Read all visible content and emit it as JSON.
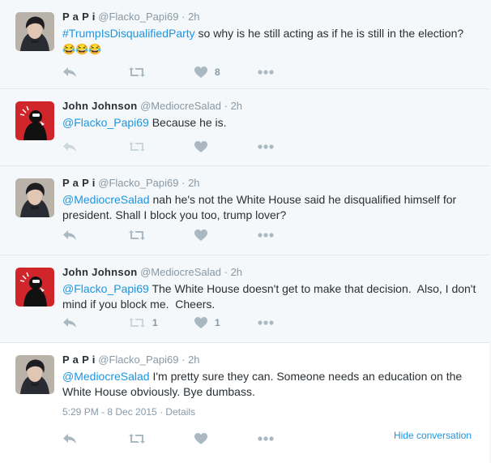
{
  "tweets": [
    {
      "fullname": "P a P i",
      "username": "@Flacko_Papi69",
      "separator": "·",
      "time": "2h",
      "parts": [
        {
          "text": "#TrumpIsDisqualifiedParty",
          "kind": "link"
        },
        {
          "text": " so why is he still acting as if he is still in the election?",
          "kind": "plain"
        }
      ],
      "emoji": "😂😂😂",
      "avatar": "avatar-papi",
      "retweet_count": "",
      "like_count": "8"
    },
    {
      "fullname": "John Johnson",
      "username": "@MediocreSalad",
      "separator": "·",
      "time": "2h",
      "parts": [
        {
          "text": "@Flacko_Papi69",
          "kind": "link"
        },
        {
          "text": " Because he is.",
          "kind": "plain"
        }
      ],
      "avatar": "avatar-john",
      "retweet_count": "",
      "like_count": ""
    },
    {
      "fullname": "P a P i",
      "username": "@Flacko_Papi69",
      "separator": "·",
      "time": "2h",
      "parts": [
        {
          "text": "@MediocreSalad",
          "kind": "link"
        },
        {
          "text": " nah he's not the White House said he disqualified himself for president. Shall I block you too, trump lover?",
          "kind": "plain"
        }
      ],
      "avatar": "avatar-papi",
      "retweet_count": "",
      "like_count": ""
    },
    {
      "fullname": "John Johnson",
      "username": "@MediocreSalad",
      "separator": "·",
      "time": "2h",
      "parts": [
        {
          "text": "@Flacko_Papi69",
          "kind": "link"
        },
        {
          "text": " The White House doesn't get to make that decision.  Also, I don't mind if you block me.  Cheers.",
          "kind": "plain"
        }
      ],
      "avatar": "avatar-john",
      "retweet_count": "1",
      "like_count": "1"
    },
    {
      "fullname": "P a P i",
      "username": "@Flacko_Papi69",
      "separator": "·",
      "time": "2h",
      "parts": [
        {
          "text": "@MediocreSalad",
          "kind": "link"
        },
        {
          "text": " I'm pretty sure they can. Someone needs an education on the White House obviously. Bye dumbass.",
          "kind": "plain"
        }
      ],
      "avatar": "avatar-papi",
      "retweet_count": "",
      "like_count": "",
      "timestamp": "5:29 PM - 8 Dec 2015",
      "details_label": "Details",
      "hide_conversation_label": "Hide conversation"
    }
  ],
  "icons": {
    "reply": "reply-icon",
    "retweet": "retweet-icon",
    "like": "heart-icon",
    "more": "more-icon"
  },
  "colors": {
    "link": "#1b95e0",
    "muted": "#8899a6",
    "icon": "#aab8c2",
    "focused_background": "#ffffff",
    "background": "#f5f8fa"
  }
}
